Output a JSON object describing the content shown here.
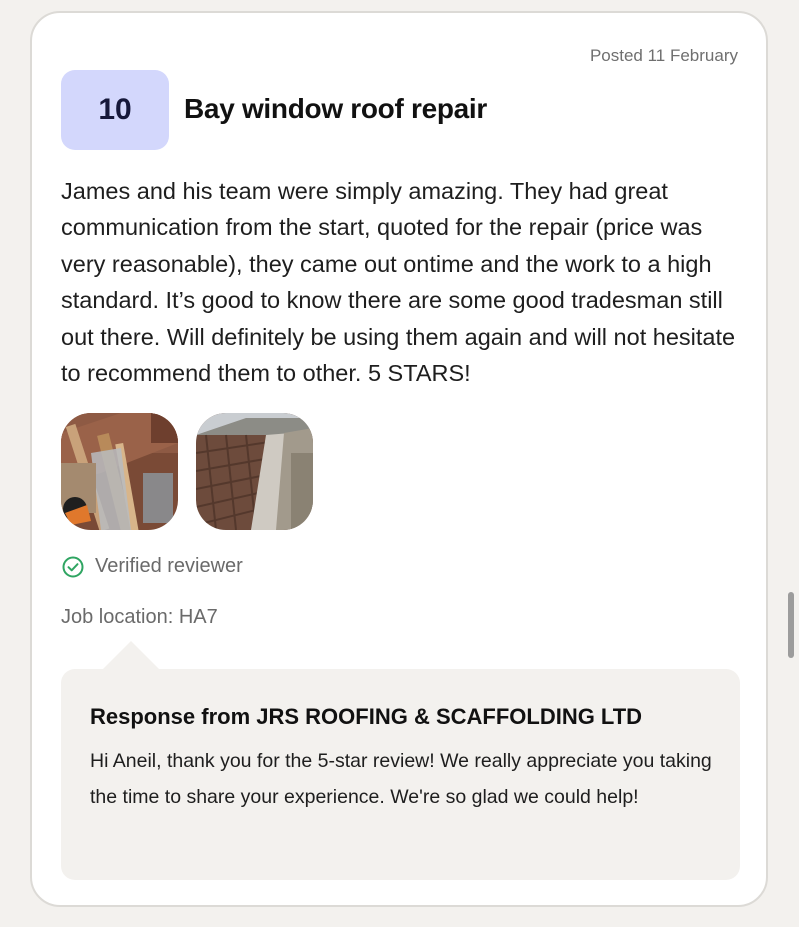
{
  "review": {
    "posted": "Posted 11 February",
    "score": "10",
    "title": "Bay window roof repair",
    "body": "James and his team were simply amazing. They had great communication from the start, quoted for the repair (price was very reasonable), they came out ontime and the work to a high standard. It’s good to know there are some good tradesman still out there. Will definitely be using them again and will not hesitate to recommend them to other. 5 STARS!",
    "photos": [
      {
        "subject": "roof repair in progress - battens and tiles with tools"
      },
      {
        "subject": "repaired tiled roof with lead flashing"
      }
    ],
    "verified_label": "Verified reviewer",
    "verified_icon": "check-circle-icon",
    "location": "Job location: HA7"
  },
  "response": {
    "title": "Response from JRS ROOFING & SCAFFOLDING LTD",
    "text": "Hi Aneil, thank you for the 5-star review! We really appreciate you taking the time to share your experience. We're so glad we could help!"
  },
  "colors": {
    "score_bg": "#d3d7fc",
    "verified_green": "#2fa562",
    "response_bg": "#f3f1ee"
  }
}
